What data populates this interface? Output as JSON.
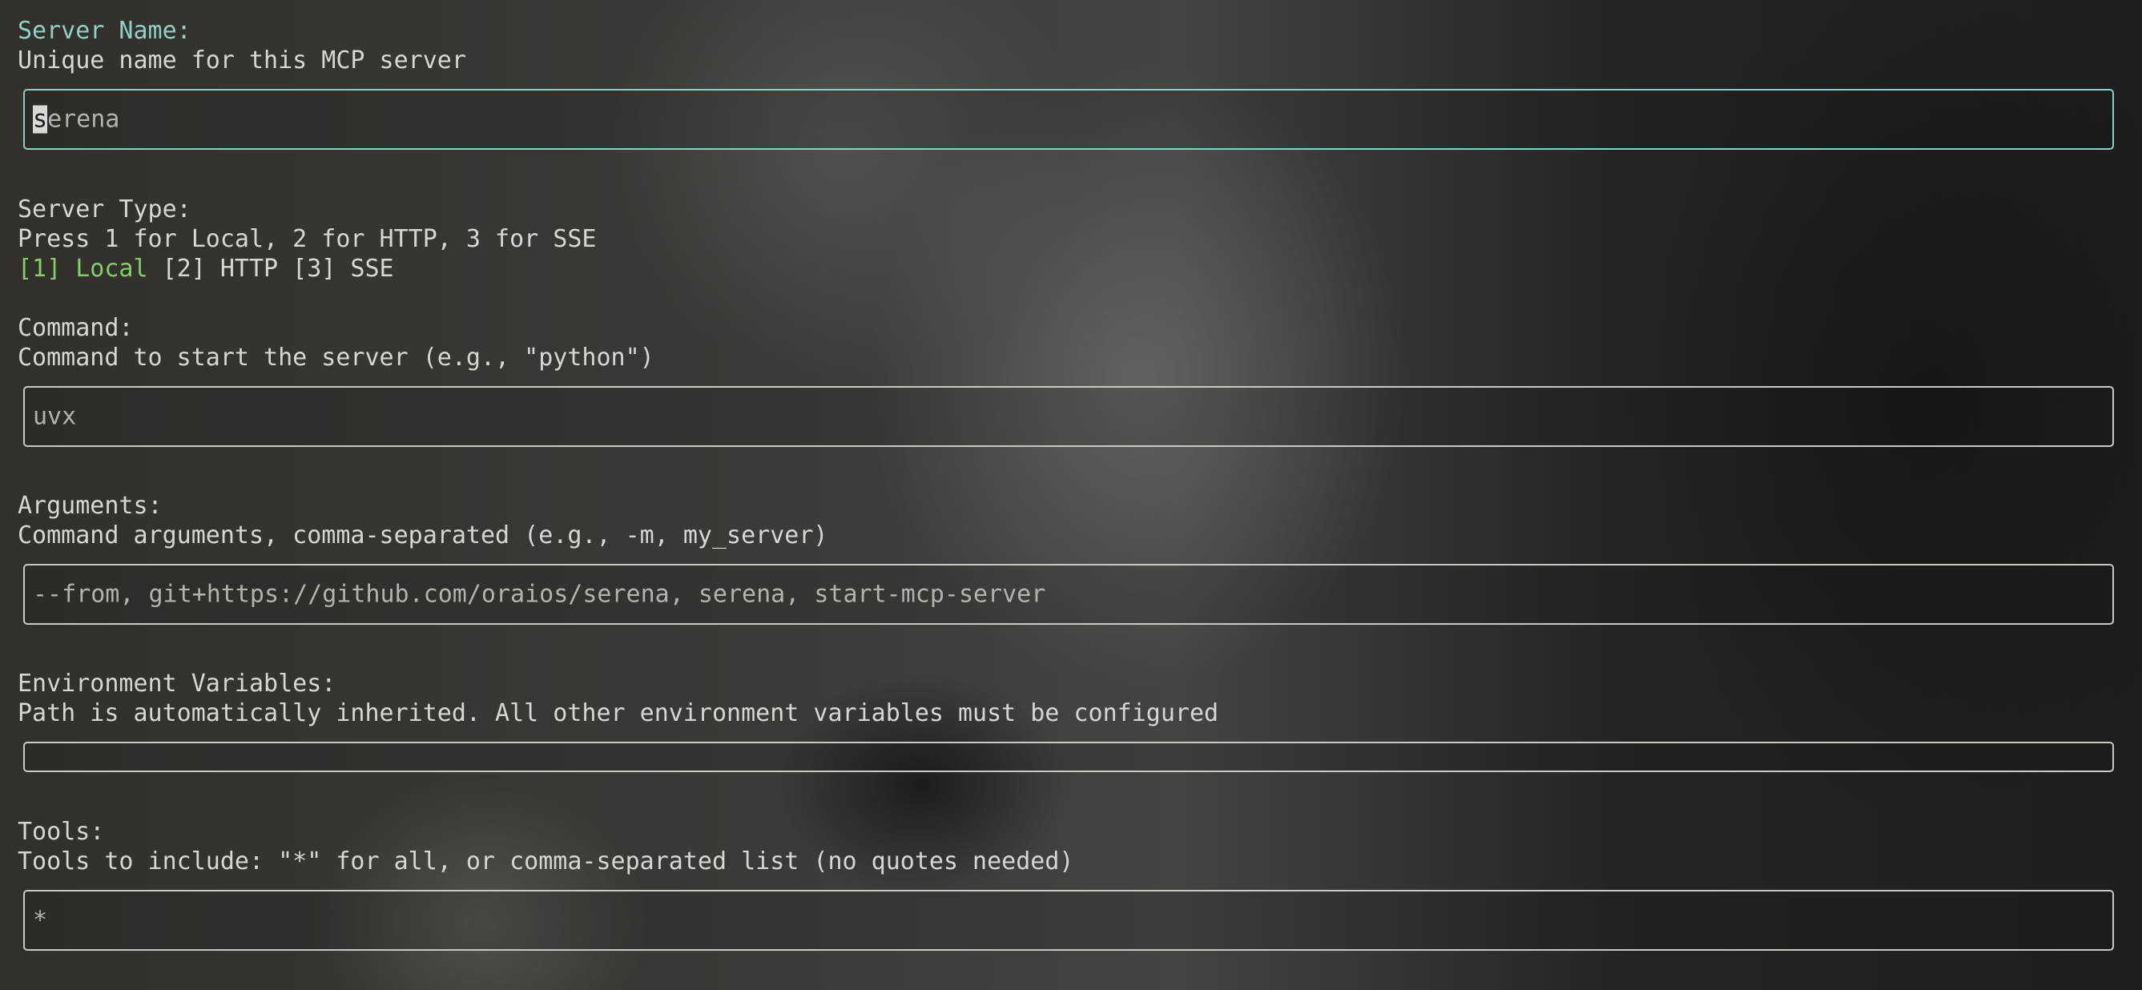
{
  "server_name": {
    "label": "Server Name:",
    "description": "Unique name for this MCP server",
    "value_cursor_char": "s",
    "value_rest": "erena"
  },
  "server_type": {
    "label": "Server Type:",
    "description": "Press 1 for Local, 2 for HTTP, 3 for SSE",
    "option_local": "[1] Local",
    "option_rest": " [2] HTTP [3] SSE"
  },
  "command": {
    "label": "Command:",
    "description": "Command to start the server (e.g., \"python\")",
    "value": "uvx"
  },
  "arguments": {
    "label": "Arguments:",
    "description": "Command arguments, comma-separated (e.g., -m, my_server)",
    "value": "--from, git+https://github.com/oraios/serena, serena, start-mcp-server"
  },
  "env_vars": {
    "label": "Environment Variables:",
    "description": "Path is automatically inherited. All other environment variables must be configured",
    "value": ""
  },
  "tools": {
    "label": "Tools:",
    "description": "Tools to include: \"*\" for all, or comma-separated list (no quotes needed)",
    "value": "*"
  },
  "colors": {
    "active_label": "#8fd0c9",
    "selected_option": "#7fcf6a",
    "active_border": "#88cfc7"
  }
}
